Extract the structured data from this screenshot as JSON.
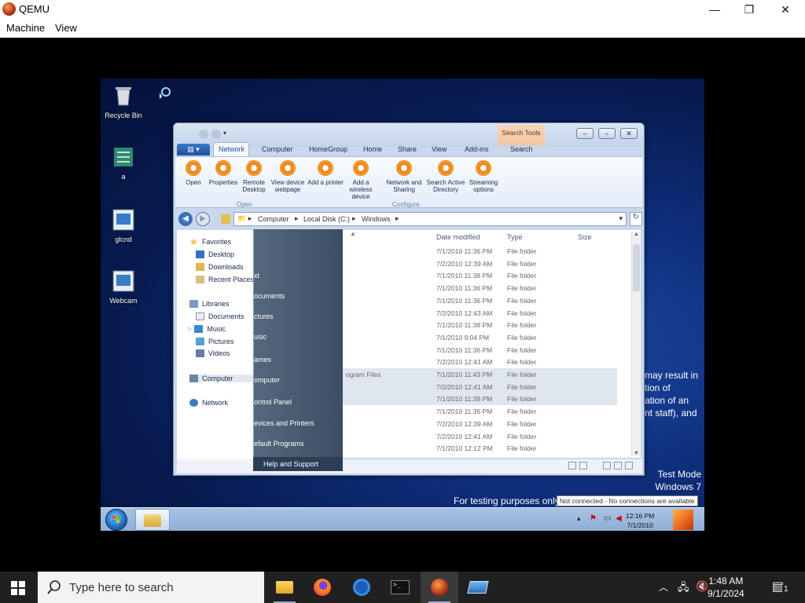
{
  "qemu": {
    "title": "QEMU",
    "menu": [
      "Machine",
      "View"
    ],
    "controls": {
      "minimize": "—",
      "restore": "❐",
      "close": "✕"
    }
  },
  "desktop": {
    "icons": [
      {
        "label": "Recycle Bin",
        "icon": "recycle-bin-icon"
      },
      {
        "label": "a",
        "icon": "network-icon"
      },
      {
        "label": "glcnd",
        "icon": "program-icon"
      },
      {
        "label": "Webcam",
        "icon": "program-icon"
      }
    ],
    "watermark": {
      "partial_lines": [
        "may result in",
        "tion of",
        "ation of an",
        "nt staff), and"
      ],
      "test_mode": "Test Mode",
      "os": "Windows 7",
      "testing": "For testing purposes only"
    }
  },
  "explorer": {
    "ribbon_tabs": [
      "Network",
      "Computer",
      "HomeGroup",
      "Home",
      "Share",
      "View",
      "Add-ins",
      "Search"
    ],
    "search_tools": "Search Tools",
    "buttons": [
      {
        "label": "Open"
      },
      {
        "label": "Properties"
      },
      {
        "label": "Remote Desktop"
      },
      {
        "label": "View device webpage"
      },
      {
        "label": "Add a printer"
      },
      {
        "label": "Add a wireless device"
      },
      {
        "label": "Network and Sharing"
      },
      {
        "label": "Search Active Directory"
      },
      {
        "label": "Streaming options"
      }
    ],
    "groups": [
      "Open",
      "Configure"
    ],
    "address": [
      "Computer",
      "Local Disk (C:)",
      "Windows"
    ],
    "nav": {
      "favorites": "Favorites",
      "desktop": "Desktop",
      "downloads": "Downloads",
      "recent": "Recent Places",
      "libraries": "Libraries",
      "documents": "Documents",
      "music": "Music",
      "pictures": "Pictures",
      "videos": "Videos",
      "computer": "Computer",
      "network": "Network"
    },
    "columns": {
      "date": "Date modified",
      "type": "Type",
      "size": "Size"
    },
    "rows": [
      {
        "name": "",
        "date": "7/1/2010 11:36 PM",
        "type": "File folder"
      },
      {
        "name": "",
        "date": "7/2/2010 12:39 AM",
        "type": "File folder"
      },
      {
        "name": "",
        "date": "7/1/2010 11:38 PM",
        "type": "File folder"
      },
      {
        "name": "",
        "date": "7/1/2010 11:36 PM",
        "type": "File folder"
      },
      {
        "name": "",
        "date": "7/1/2010 11:36 PM",
        "type": "File folder"
      },
      {
        "name": "",
        "date": "7/2/2010 12:43 AM",
        "type": "File folder"
      },
      {
        "name": "",
        "date": "7/1/2010 11:38 PM",
        "type": "File folder"
      },
      {
        "name": "",
        "date": "7/1/2010 9:04 PM",
        "type": "File folder"
      },
      {
        "name": "",
        "date": "7/1/2010 11:36 PM",
        "type": "File folder"
      },
      {
        "name": "",
        "date": "7/2/2010 12:41 AM",
        "type": "File folder"
      },
      {
        "name": "ogram Files",
        "date": "7/1/2010 11:43 PM",
        "type": "File folder"
      },
      {
        "name": "",
        "date": "7/2/2010 12:41 AM",
        "type": "File folder"
      },
      {
        "name": "",
        "date": "7/1/2010 11:39 PM",
        "type": "File folder"
      },
      {
        "name": "",
        "date": "7/1/2010 11:36 PM",
        "type": "File folder"
      },
      {
        "name": "",
        "date": "7/2/2010 12:39 AM",
        "type": "File folder"
      },
      {
        "name": "",
        "date": "7/2/2010 12:41 AM",
        "type": "File folder"
      },
      {
        "name": "",
        "date": "7/1/2010 12:12 PM",
        "type": "File folder"
      }
    ]
  },
  "startmenu": {
    "items": [
      "xt",
      "ocuments",
      "ctures",
      "usic",
      "ames",
      "omputer",
      "ontrol Panel",
      "evices and Printers",
      "efault Programs"
    ],
    "help": "Help and Support"
  },
  "guest_taskbar": {
    "time": "12:16 PM",
    "date": "7/1/2010",
    "tooltip": "Not connected - No connections are available"
  },
  "host_taskbar": {
    "search_placeholder": "Type here to search",
    "time": "1:48 AM",
    "date": "9/1/2024",
    "notification_count": "1"
  }
}
